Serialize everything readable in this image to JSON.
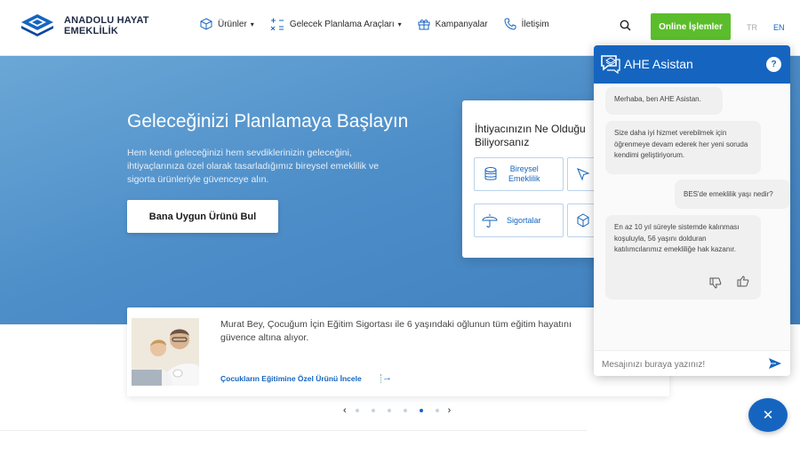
{
  "brand": {
    "line1": "ANADOLU HAYAT",
    "line2": "EMEKLİLİK"
  },
  "nav": {
    "items": [
      {
        "label": "Ürünler",
        "icon": "box-icon",
        "dropdown": true
      },
      {
        "label": "Gelecek Planlama Araçları",
        "icon": "calculator-icon",
        "dropdown": true
      },
      {
        "label": "Kampanyalar",
        "icon": "gift-icon",
        "dropdown": false
      },
      {
        "label": "İletişim",
        "icon": "phone-icon",
        "dropdown": false
      }
    ],
    "online_button": "Online İşlemler",
    "lang_tr": "TR",
    "lang_en": "EN"
  },
  "hero": {
    "title": "Geleceğinizi Planlamaya Başlayın",
    "description": "Hem kendi geleceğinizi hem sevdiklerinizin geleceğini, ihtiyaçlarınıza özel olarak tasarladığımız bireysel emeklilik ve sigorta ürünleriyle güvenceye alın.",
    "cta": "Bana Uygun Ürünü Bul"
  },
  "needs": {
    "title_line1": "İhtiyacınızın Ne Olduğu",
    "title_line2": "Biliyorsanız",
    "tiles": [
      {
        "label_line1": "Bireysel",
        "label_line2": "Emeklilik",
        "icon": "coins-icon"
      },
      {
        "label": "",
        "icon": "cursor-icon"
      },
      {
        "label": "Sigortalar",
        "icon": "umbrella-icon"
      },
      {
        "label": "",
        "icon": "cube-icon"
      }
    ]
  },
  "promo": {
    "text": "Murat Bey, Çocuğum İçin Eğitim Sigortası ile 6 yaşındaki oğlunun tüm eğitim hayatını güvence altına alıyor.",
    "link": "Çocukların Eğitimine Özel Ürünü İncele",
    "arrow": "→"
  },
  "carousel": {
    "prev": "‹",
    "next": "›",
    "dot_count": 6,
    "active_index": 4
  },
  "chat": {
    "title": "AHE Asistan",
    "help": "?",
    "messages": [
      {
        "from": "bot",
        "text": "Merhaba, ben AHE Asistan."
      },
      {
        "from": "bot",
        "text": "Size daha iyi hizmet verebilmek için öğrenmeye devam ederek her yeni soruda kendimi geliştiriyorum."
      },
      {
        "from": "user",
        "text": "BES'de emeklilik yaşı nedir?"
      },
      {
        "from": "bot",
        "text": "En az 10 yıl süreyle sistemde kalınması koşuluyla, 56 yaşını dolduran katılımcılarımız emekliliğe hak kazanır."
      }
    ],
    "input_placeholder": "Mesajınızı buraya yazınız!",
    "close": "✕"
  },
  "colors": {
    "brand_blue": "#1565c0",
    "online_green": "#5bbd2b",
    "hero_blue": "#4d8ec9"
  }
}
